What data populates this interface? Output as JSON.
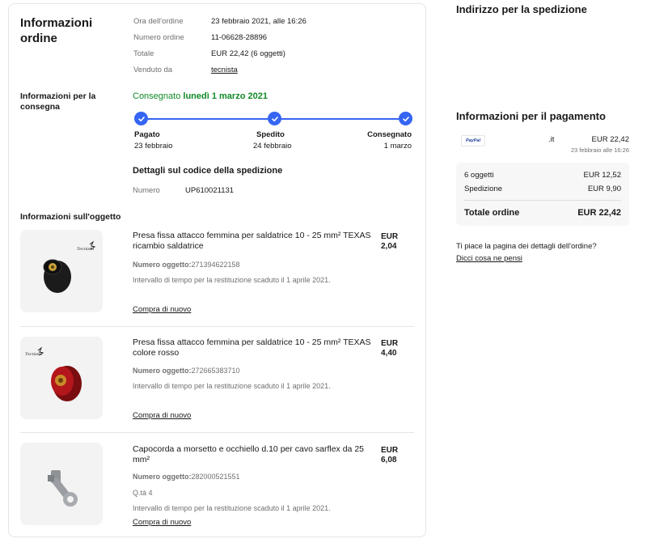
{
  "order": {
    "title": "Informazioni ordine",
    "rows": [
      {
        "label": "Ora dell'ordine",
        "value": "23 febbraio 2021, alle 16:26"
      },
      {
        "label": "Numero ordine",
        "value": "11-06628-28896"
      },
      {
        "label": "Totale",
        "value": "EUR 22,42 (6 oggetti)"
      },
      {
        "label": "Venduto da",
        "value": "tecnista"
      }
    ]
  },
  "delivery": {
    "title": "Informazioni per la consegna",
    "status_prefix": "Consegnato ",
    "status_date": "lunedì 1 marzo 2021",
    "steps": [
      {
        "label": "Pagato",
        "date": "23 febbraio"
      },
      {
        "label": "Spedito",
        "date": "24 febbraio"
      },
      {
        "label": "Consegnato",
        "date": "1 marzo"
      }
    ],
    "tracking_title": "Dettagli sul codice della spedizione",
    "tracking_label": "Numero",
    "tracking_value": "UP610021131"
  },
  "items_section": {
    "title": "Informazioni sull'oggetto",
    "items": [
      {
        "name": "Presa fissa attacco femmina per saldatrice 10 - 25 mm² TEXAS ricambio saldatrice",
        "price": "EUR 2,04",
        "number_label": "Numero oggetto:",
        "number": "271394622158",
        "qty": "",
        "return": "Intervallo di tempo per la restituzione scaduto il 1 aprile 2021.",
        "buy_again": "Compra di nuovo"
      },
      {
        "name": "Presa fissa attacco femmina per saldatrice 10 - 25 mm² TEXAS colore rosso",
        "price": "EUR 4,40",
        "number_label": "Numero oggetto:",
        "number": "272665383710",
        "qty": "",
        "return": "Intervallo di tempo per la restituzione scaduto il 1 aprile 2021.",
        "buy_again": "Compra di nuovo"
      },
      {
        "name": "Capocorda a morsetto e occhiello d.10 per cavo sarflex da 25 mm²",
        "price": "EUR 6,08",
        "number_label": "Numero oggetto:",
        "number": "282000521551",
        "qty": "Q.tà 4",
        "return": "Intervallo di tempo per la restituzione scaduto il 1 aprile 2021.",
        "buy_again": "Compra di nuovo"
      }
    ]
  },
  "shipping_address": {
    "title": "Indirizzo per la spedizione"
  },
  "payment": {
    "title": "Informazioni per il pagamento",
    "method_badge": "PayPal",
    "method_suffix": ".it",
    "amount": "EUR 22,42",
    "date": "23 febbraio alle 16:26",
    "items_label": "6 oggetti",
    "items_value": "EUR 12,52",
    "shipping_label": "Spedizione",
    "shipping_value": "EUR 9,90",
    "total_label": "Totale ordine",
    "total_value": "EUR 22,42"
  },
  "feedback": {
    "question": "Ti piace la pagina dei dettagli dell'ordine?",
    "link": "Dicci cosa ne pensi"
  },
  "brand_logo_text": "Tecnista",
  "colors": {
    "accent": "#3665f3",
    "delivered": "#118a27"
  }
}
